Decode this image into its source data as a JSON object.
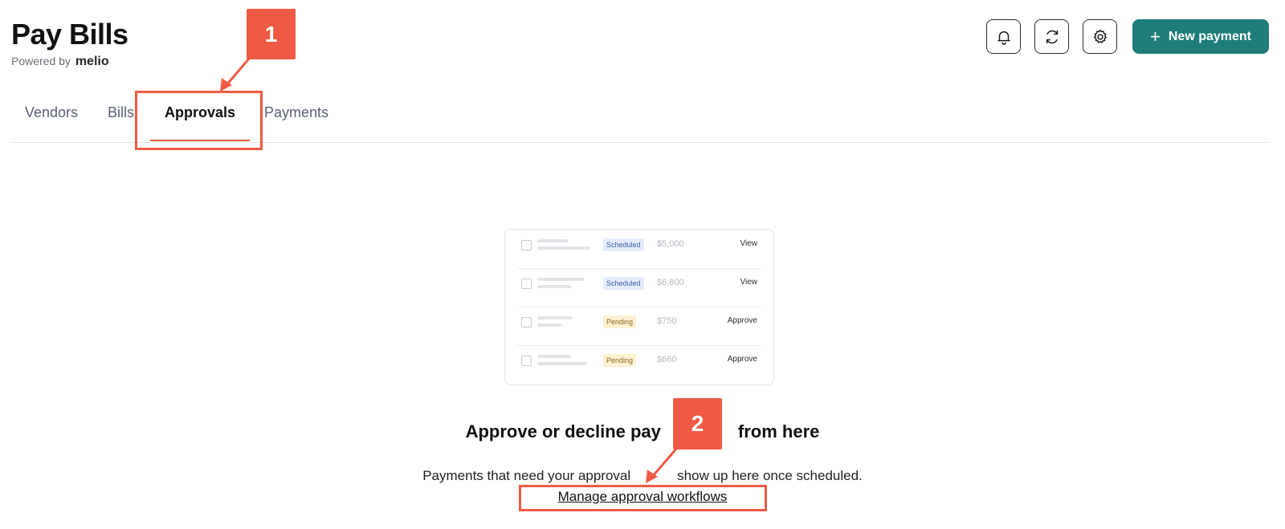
{
  "header": {
    "title": "Pay Bills",
    "powered_prefix": "Powered by",
    "powered_brand": "melio",
    "actions": {
      "notifications_icon": "bell-icon",
      "refresh_icon": "refresh-icon",
      "settings_icon": "gear-icon",
      "new_payment_label": "New payment",
      "new_payment_icon": "+"
    },
    "accent_color": "#1f7d7a"
  },
  "tabs": [
    {
      "label": "Vendors",
      "active": false
    },
    {
      "label": "Bills",
      "active": false
    },
    {
      "label": "Approvals",
      "active": true
    },
    {
      "label": "Payments",
      "active": false
    }
  ],
  "illustration": {
    "rows": [
      {
        "status": "Scheduled",
        "amount": "$5,000",
        "action": "View"
      },
      {
        "status": "Scheduled",
        "amount": "$6,800",
        "action": "View"
      },
      {
        "status": "Pending",
        "amount": "$750",
        "action": "Approve"
      },
      {
        "status": "Pending",
        "amount": "$660",
        "action": "Approve"
      }
    ]
  },
  "empty_state": {
    "title_before": "Approve or decline pay",
    "title_after": "from here",
    "description": "Payments that need your approval",
    "description_rest": "show up here once scheduled.",
    "manage_link": "Manage approval workflows"
  },
  "annotations": {
    "callout_1": "1",
    "callout_2": "2",
    "color": "#ef5a45"
  }
}
